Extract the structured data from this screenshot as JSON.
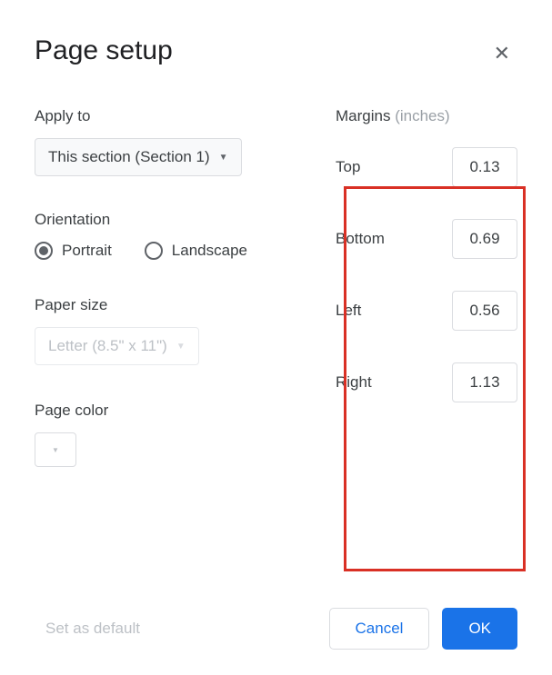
{
  "dialog": {
    "title": "Page setup"
  },
  "applyTo": {
    "label": "Apply to",
    "value": "This section (Section 1)"
  },
  "orientation": {
    "label": "Orientation",
    "options": {
      "portrait": "Portrait",
      "landscape": "Landscape"
    },
    "selected": "portrait"
  },
  "paperSize": {
    "label": "Paper size",
    "value": "Letter (8.5\" x 11\")"
  },
  "pageColor": {
    "label": "Page color"
  },
  "margins": {
    "label": "Margins",
    "unit": "(inches)",
    "items": {
      "top": {
        "label": "Top",
        "value": "0.13"
      },
      "bottom": {
        "label": "Bottom",
        "value": "0.69"
      },
      "left": {
        "label": "Left",
        "value": "0.56"
      },
      "right": {
        "label": "Right",
        "value": "1.13"
      }
    }
  },
  "footer": {
    "setDefault": "Set as default",
    "cancel": "Cancel",
    "ok": "OK"
  }
}
